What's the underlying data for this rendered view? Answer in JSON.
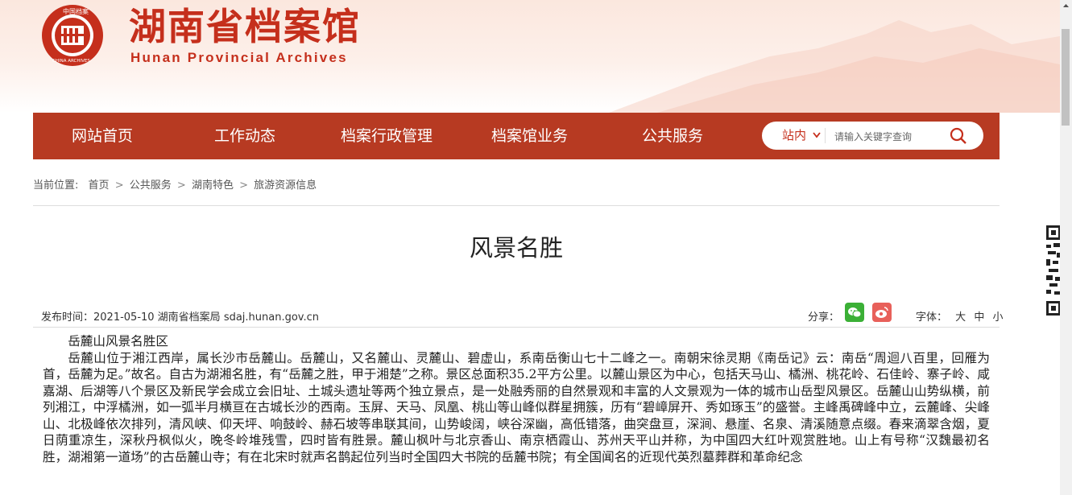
{
  "header": {
    "logo_ring_text": "中国档案",
    "logo_bottom_text": "CHINA ARCHIVES",
    "title": "湖南省档案馆",
    "subtitle": "Hunan Provincial Archives"
  },
  "nav": {
    "items": [
      {
        "label": "网站首页"
      },
      {
        "label": "工作动态"
      },
      {
        "label": "档案行政管理"
      },
      {
        "label": "档案馆业务"
      },
      {
        "label": "公共服务"
      }
    ],
    "search_scope": "站内",
    "search_placeholder": "请输入关键字查询",
    "search_icon": "search-icon",
    "chevron_icon": "chevron-down-icon"
  },
  "breadcrumb": {
    "prefix": "当前位置:",
    "items": [
      "首页",
      "公共服务",
      "湖南特色",
      "旅游资源信息"
    ],
    "separator": ">"
  },
  "article": {
    "title": "风景名胜",
    "meta": "发布时间：2021-05-10 湖南省档案局 sdaj.hunan.gov.cn",
    "share_label": "分享：",
    "share_icons": [
      "wechat-icon",
      "weibo-icon"
    ],
    "font_label": "字体：",
    "font_options": [
      "大",
      "中",
      "小"
    ],
    "heading": "岳麓山风景名胜区",
    "body": "岳麓山位于湘江西岸，属长沙市岳麓山。岳麓山，又名麓山、灵麓山、碧虚山，系南岳衡山七十二峰之一。南朝宋徐灵期《南岳记》云：南岳“周迴八百里，回雁为首，岳麓为足。”故名。自古为湖湘名胜，有“岳麓之胜，甲于湘楚”之称。景区总面积35.2平方公里。以麓山景区为中心，包括天马山、橘洲、桃花岭、石佳岭、寨子岭、咸嘉湖、后湖等八个景区及新民学会成立会旧址、土城头遗址等两个独立景点，是一处融秀丽的自然景观和丰富的人文景观为一体的城市山岳型风景区。岳麓山山势纵横，前列湘江，中浮橘洲，如一弧半月横亘在古城长沙的西南。玉屏、天马、凤凰、桃山等山峰似群星拥簇，历有“碧嶂屏开、秀如琢玉”的盛誉。主峰禹碑峰中立，云麓峰、尖峰山、北极峰依次排列，清风峡、仰天坪、响鼓岭、赫石坡等串联其间，山势峻阔，峡谷深幽，高低错落，曲突盘亘，深涧、悬崖、名泉、清溪随意点缀。春来滴翠含烟，夏日荫重凉生，深秋丹枫似火，晚冬岭堆残雪，四时皆有胜景。麓山枫叶与北京香山、南京栖霞山、苏州天平山并称，为中国四大红叶观赏胜地。山上有号称“汉魏最初名胜，湖湘第一道场”的古岳麓山寺；有在北宋时就声名鹊起位列当时全国四大书院的岳麓书院；有全国闻名的近现代英烈墓葬群和革命纪念"
  },
  "colors": {
    "brand_red": "#c52f1c",
    "nav_bg": "#b73a22",
    "wechat_green": "#3bb036",
    "weibo_red": "#e8605a"
  }
}
